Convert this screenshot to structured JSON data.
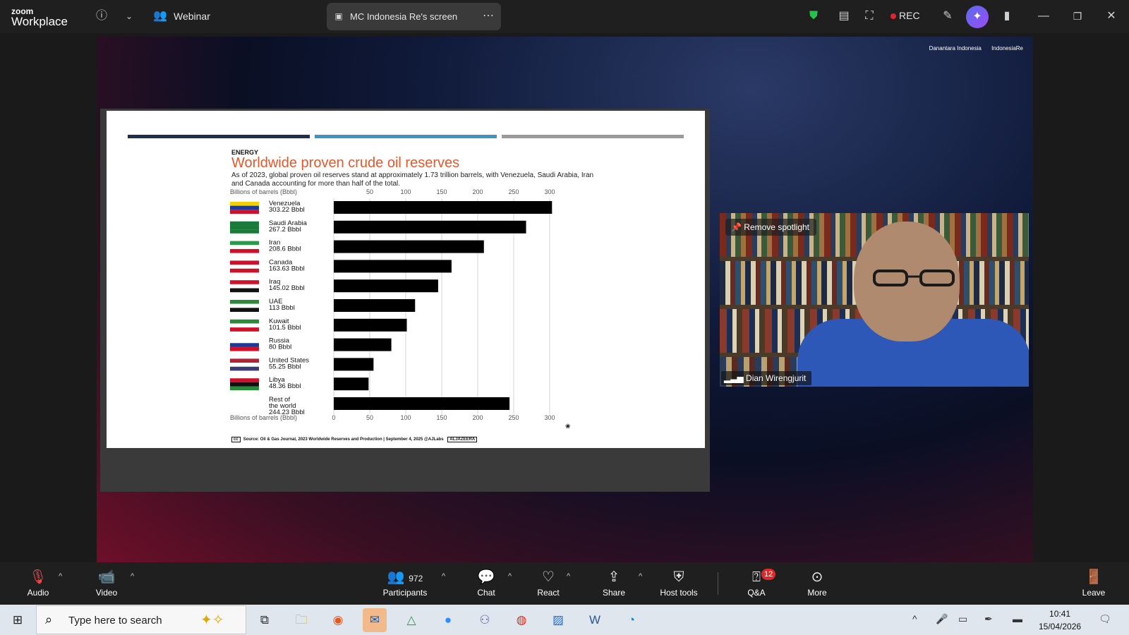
{
  "titlebar": {
    "logo_top": "zoom",
    "logo_bottom": "Workplace",
    "webinar_label": "Webinar",
    "screen_tab_label": "MC Indonesia Re's screen",
    "rec_label": "REC"
  },
  "stage": {
    "sponsors": [
      "Danantara Indonesia",
      "IndonesiaRe"
    ],
    "slide": {
      "kicker": "ENERGY",
      "title": "Worldwide proven crude oil reserves",
      "subtitle": "As of 2023, global proven oil reserves stand at approximately 1.73 trillion barrels, with Venezuela, Saudi Arabia, Iran and Canada accounting for more than half of the total.",
      "source": "Source: Oil & Gas Journal, 2023 Worldwide Reserves and Production  |  September 4, 2025   @AJLabs",
      "publisher": "ALJAZEERA",
      "accent_colors": [
        "#1f2d4e",
        "#3f95c0",
        "#9a9a9a"
      ],
      "title_color": "#e8562a"
    }
  },
  "chart_data": {
    "type": "bar",
    "orientation": "horizontal",
    "axis_label": "Billions of barrels (Bbbl)",
    "xlim": [
      0,
      300
    ],
    "xticks": [
      0,
      50,
      100,
      150,
      200,
      250,
      300
    ],
    "top_ticks": [
      50,
      100,
      150,
      200,
      250,
      300
    ],
    "categories": [
      "Venezuela",
      "Saudi Arabia",
      "Iran",
      "Canada",
      "Iraq",
      "UAE",
      "Kuwait",
      "Russia",
      "United States",
      "Libya",
      "Rest of the world"
    ],
    "value_labels": [
      "303.22 Bbbl",
      "267.2 Bbbl",
      "208.6 Bbbl",
      "163.63 Bbbl",
      "145.02 Bbbl",
      "113 Bbbl",
      "101.5 Bbbl",
      "80 Bbbl",
      "55.25 Bbbl",
      "48.36 Bbbl",
      "244.23 Bbbl"
    ],
    "values": [
      303.22,
      267.2,
      208.6,
      163.63,
      145.02,
      113,
      101.5,
      80,
      55.25,
      48.36,
      244.23
    ],
    "bar_color": "#000000",
    "grid": true
  },
  "video": {
    "spotlight_button": "Remove spotlight",
    "participant_name": "Dian Wirengjurit"
  },
  "controls": {
    "audio": "Audio",
    "video": "Video",
    "participants": "Participants",
    "participants_count": "972",
    "chat": "Chat",
    "react": "React",
    "share": "Share",
    "host_tools": "Host tools",
    "qa": "Q&A",
    "qa_badge": "12",
    "more": "More",
    "leave": "Leave"
  },
  "taskbar": {
    "search_placeholder": "Type here to search",
    "time": "10:41",
    "date": "15/04/2026"
  }
}
